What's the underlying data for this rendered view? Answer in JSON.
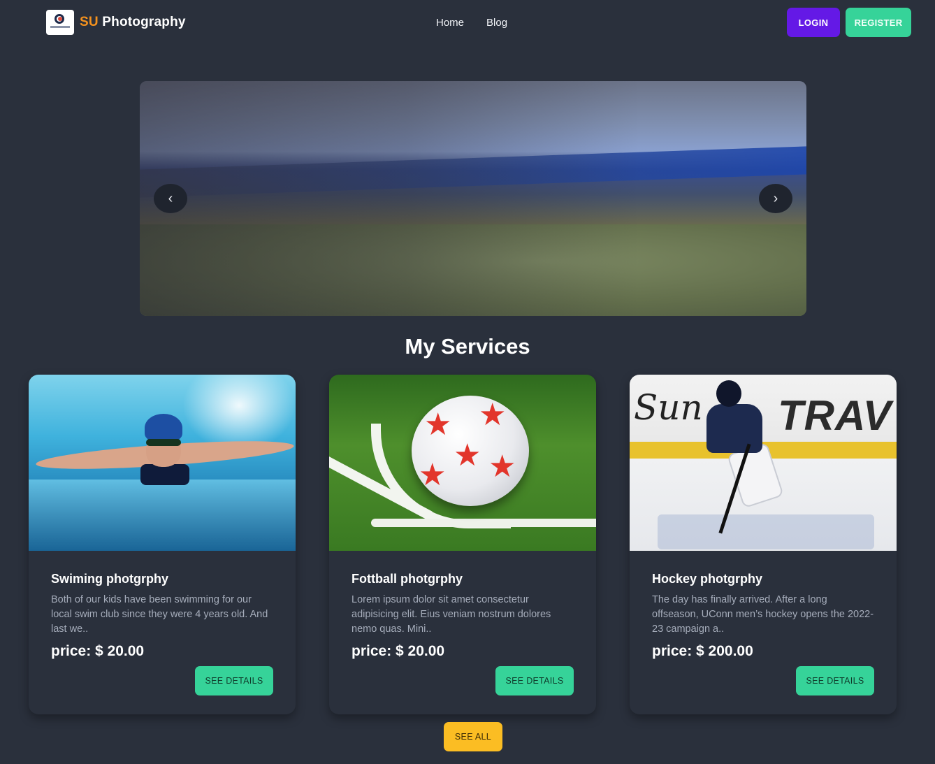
{
  "navbar": {
    "brand_accent": "SU",
    "brand_rest": " Photography",
    "links": [
      {
        "label": "Home"
      },
      {
        "label": "Blog"
      }
    ],
    "login_label": "LOGIN",
    "register_label": "REGISTER"
  },
  "carousel": {
    "prev_icon": "chevron-left-icon",
    "next_icon": "chevron-right-icon",
    "prev_glyph": "‹",
    "next_glyph": "›"
  },
  "services": {
    "title": "My Services",
    "cards": [
      {
        "title": "Swiming photgrphy",
        "description": "Both of our kids have been swimming for our local swim club since they were 4 years old. And last we..",
        "price": "price: $ 20.00",
        "button": "SEE DETAILS"
      },
      {
        "title": "Fottball photgrphy",
        "description": "Lorem ipsum dolor sit amet consectetur adipisicing elit. Eius veniam nostrum dolores nemo quas. Mini..",
        "price": "price: $ 20.00",
        "button": "SEE DETAILS"
      },
      {
        "title": "Hockey photgrphy",
        "description": "The day has finally arrived. After a long offseason, UConn men’s hockey opens the 2022-23 campaign a..",
        "price": "price: $ 200.00",
        "button": "SEE DETAILS"
      }
    ],
    "see_all_label": "SEE ALL"
  },
  "photo_text": {
    "hockey_sign_left": "Sun",
    "hockey_sign_right": "TRAV"
  },
  "colors": {
    "background": "#2a303c",
    "primary": "#6419e6",
    "accent": "#36d399",
    "warning": "#fbbd23",
    "brand_orange": "#f5921e"
  }
}
